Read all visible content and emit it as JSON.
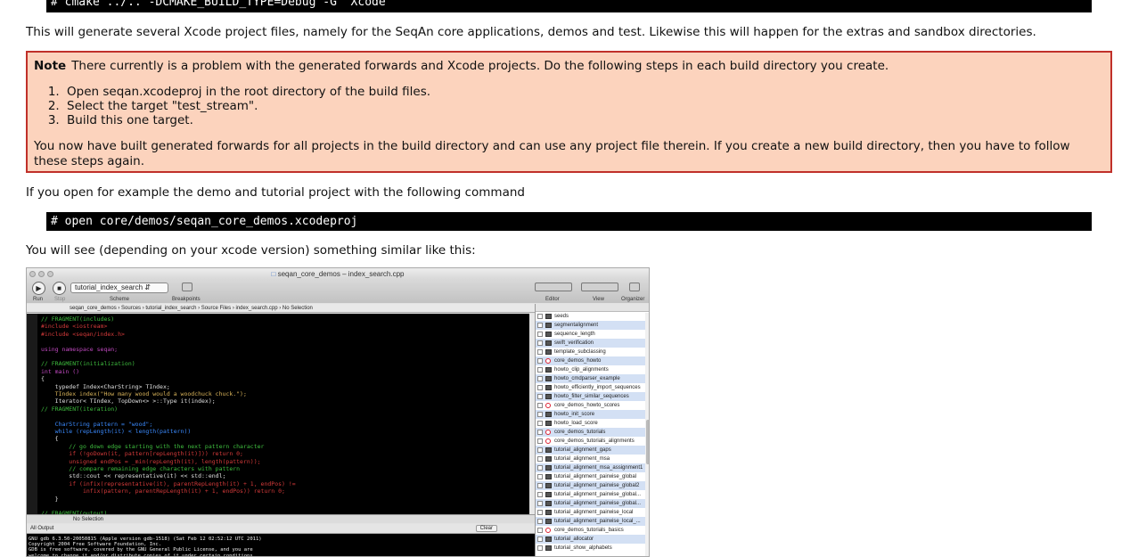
{
  "top_code": "# cmake ../.. -DCMAKE_BUILD_TYPE=Debug -G \"Xcode\"",
  "para1": "This will generate several Xcode project files, namely for the SeqAn core applications, demos and test. Likewise this will happen for the extras and sandbox directories.",
  "note": {
    "label": "Note",
    "text": "There currently is a problem with the generated forwards and Xcode projects. Do the following steps in each build directory you create.",
    "steps": [
      "Open seqan.xcodeproj in the root directory of the build files.",
      "Select the target \"test_stream\".",
      "Build this one target."
    ],
    "tail": "You now have built generated forwards for all projects in the build directory and can use any project file therein. If you create a new build directory, then you have to follow these steps again."
  },
  "para2": "If you open for example the demo and tutorial project with the following command",
  "open_code": "# open core/demos/seqan_core_demos.xcodeproj",
  "para3": "You will see (depending on your xcode version) something similar like this:",
  "xcode": {
    "title": "seqan_core_demos – index_search.cpp",
    "toolbar": {
      "run": "Run",
      "stop": "Stop",
      "scheme_value": "tutorial_index_search",
      "scheme": "Scheme",
      "breakpoints": "Breakpoints",
      "editor": "Editor",
      "view": "View",
      "organizer": "Organizer"
    },
    "jumpbar": [
      "seqan_core_demos",
      "Sources",
      "tutorial_index_search",
      "Source Files",
      "index_search.cpp",
      "No Selection"
    ],
    "code_lines": [
      "// FRAGMENT(includes)",
      "#include <iostream>",
      "#include <seqan/index.h>",
      "",
      "using namespace seqan;",
      "",
      "// FRAGMENT(initialization)",
      "int main ()",
      "{",
      "    typedef Index<CharString> TIndex;",
      "    TIndex index(\"How many wood would a woodchuck chuck.\");",
      "    Iterator< TIndex, TopDown<> >::Type it(index);",
      "// FRAGMENT(iteration)",
      "",
      "    CharString pattern = \"wood\";",
      "    while (repLength(it) < length(pattern))",
      "    {",
      "        // go down edge starting with the next pattern character",
      "        if (!goDown(it, pattern[repLength(it)])) return 0;",
      "        unsigned endPos = _min(repLength(it), length(pattern));",
      "        // compare remaining edge characters with pattern",
      "        std::cout << representative(it) << std::endl;",
      "        if (infix(representative(it), parentRepLength(it) + 1, endPos) !=",
      "            infix(pattern, parentRepLength(it) + 1, endPos)) return 0;",
      "    }",
      "",
      "// FRAGMENT(output)"
    ],
    "debug_status": "No Selection",
    "output_label": "All Output",
    "clear": "Clear",
    "console_lines": [
      "GNU gdb 6.3.50-20050815 (Apple version gdb-1518) (Sat Feb 12 02:52:12 UTC 2011)",
      "Copyright 2004 Free Software Foundation, Inc.",
      "GDB is free software, covered by the GNU General Public License, and you are",
      "welcome to change it and/or distribute copies of it under certain conditions."
    ],
    "navigator": [
      {
        "name": "seeds",
        "type": "target"
      },
      {
        "name": "segmentalignment",
        "type": "target"
      },
      {
        "name": "sequence_length",
        "type": "target"
      },
      {
        "name": "swift_verification",
        "type": "target"
      },
      {
        "name": "template_subclassing",
        "type": "target"
      },
      {
        "name": "core_demos_howto",
        "type": "aggregate"
      },
      {
        "name": "howto_clip_alignments",
        "type": "target"
      },
      {
        "name": "howto_cmdparser_example",
        "type": "target"
      },
      {
        "name": "howto_efficiently_import_sequences",
        "type": "target"
      },
      {
        "name": "howto_filter_similar_sequences",
        "type": "target"
      },
      {
        "name": "core_demos_howto_scores",
        "type": "aggregate"
      },
      {
        "name": "howto_init_score",
        "type": "target"
      },
      {
        "name": "howto_load_score",
        "type": "target"
      },
      {
        "name": "core_demos_tutorials",
        "type": "aggregate"
      },
      {
        "name": "core_demos_tutorials_alignments",
        "type": "aggregate"
      },
      {
        "name": "tutorial_alignment_gaps",
        "type": "target"
      },
      {
        "name": "tutorial_alignment_msa",
        "type": "target"
      },
      {
        "name": "tutorial_alignment_msa_assignment1",
        "type": "target"
      },
      {
        "name": "tutorial_alignment_pairwise_global",
        "type": "target"
      },
      {
        "name": "tutorial_alignment_pairwise_global2",
        "type": "target"
      },
      {
        "name": "tutorial_alignment_pairwise_global...",
        "type": "target"
      },
      {
        "name": "tutorial_alignment_pairwise_global...",
        "type": "target"
      },
      {
        "name": "tutorial_alignment_pairwise_local",
        "type": "target"
      },
      {
        "name": "tutorial_alignment_pairwise_local_...",
        "type": "target"
      },
      {
        "name": "core_demos_tutorials_basics",
        "type": "aggregate"
      },
      {
        "name": "tutorial_allocator",
        "type": "target"
      },
      {
        "name": "tutorial_show_alphabets",
        "type": "target"
      }
    ]
  }
}
